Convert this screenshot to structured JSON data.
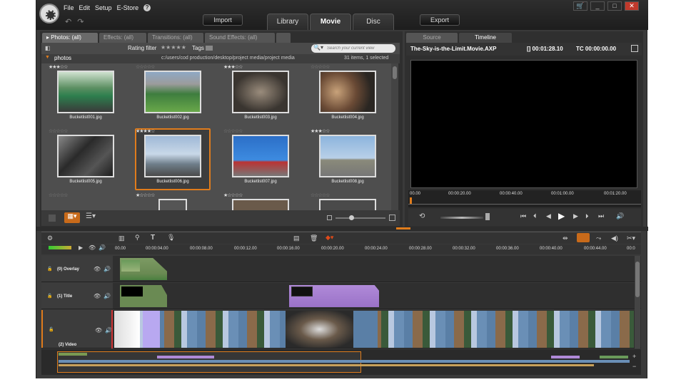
{
  "menu": {
    "file": "File",
    "edit": "Edit",
    "setup": "Setup",
    "estore": "E-Store",
    "help": "?"
  },
  "toolbar": {
    "import": "Import",
    "export": "Export"
  },
  "main_tabs": [
    {
      "label": "Library"
    },
    {
      "label": "Movie",
      "active": true
    },
    {
      "label": "Disc"
    }
  ],
  "library": {
    "tabs": [
      {
        "label": "▸ Photos: (all)"
      },
      {
        "label": "Effects: (all)"
      },
      {
        "label": "Transitions: (all)"
      },
      {
        "label": "Sound Effects: (all)"
      }
    ],
    "rating_filter": "Rating filter",
    "tags": "Tags",
    "search_placeholder": "Search your current view",
    "folder": "photos",
    "path": "c:/users/cod production/desktop/project media/project media",
    "count": "31 items, 1 selected",
    "items": [
      {
        "name": "Bucketlist001.jpg",
        "stars": "★★★☆☆"
      },
      {
        "name": "Bucketlist002.jpg",
        "stars": "☆☆☆☆☆"
      },
      {
        "name": "Bucketlist003.jpg",
        "stars": "★★★☆☆"
      },
      {
        "name": "Bucketlist004.jpg",
        "stars": "☆☆☆☆☆"
      },
      {
        "name": "Bucketlist005.jpg",
        "stars": "☆☆☆☆☆"
      },
      {
        "name": "Bucketlist006.jpg",
        "stars": "★★★★☆",
        "selected": true
      },
      {
        "name": "Bucketlist007.jpg",
        "stars": "☆☆☆☆☆"
      },
      {
        "name": "Bucketlist008.jpg",
        "stars": "★★★☆☆"
      },
      {
        "name": "",
        "stars": "☆☆☆☆☆"
      },
      {
        "name": "",
        "stars": "★☆☆☆☆"
      },
      {
        "name": "",
        "stars": "★☆☆☆☆"
      },
      {
        "name": "",
        "stars": "☆☆☆☆☆"
      }
    ]
  },
  "player": {
    "tabs": [
      {
        "label": "Source"
      },
      {
        "label": "Timeline",
        "active": true
      }
    ],
    "title": "The-Sky-is-the-Limit.Movie.AXP",
    "duration": "[] 00:01:28.10",
    "tc": "TC 00:00:00.00",
    "ruler": [
      "00.00",
      "00:00:20.00",
      "00:00:40.00",
      "00:01:00.00",
      "00:01:20.00"
    ]
  },
  "timeline": {
    "ruler": [
      "00.00",
      "00:00:04.00",
      "00:00:08.00",
      "00:00:12.00",
      "00:00:16.00",
      "00:00:20.00",
      "00:00:24.00",
      "00:00:28.00",
      "00:00:32.00",
      "00:00:36.00",
      "00:00:40.00",
      "00:00:44.00",
      "00:0"
    ],
    "tracks": [
      {
        "label": "(0) Overlay"
      },
      {
        "label": "(1) Title"
      },
      {
        "label": "(2) Video"
      }
    ]
  }
}
